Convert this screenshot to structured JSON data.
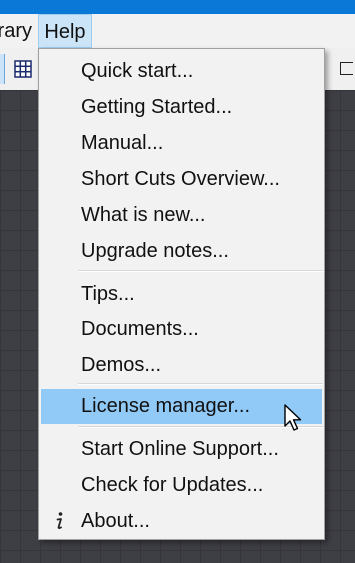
{
  "menubar": {
    "items": [
      {
        "label": "rary"
      },
      {
        "label": "Help"
      }
    ]
  },
  "help_menu": {
    "items": [
      {
        "label": "Quick start..."
      },
      {
        "label": "Getting Started..."
      },
      {
        "label": "Manual..."
      },
      {
        "label": "Short Cuts Overview..."
      },
      {
        "label": "What is new..."
      },
      {
        "label": "Upgrade notes..."
      },
      {
        "label": "Tips..."
      },
      {
        "label": "Documents..."
      },
      {
        "label": "Demos..."
      },
      {
        "label": "License manager...",
        "highlighted": true
      },
      {
        "label": "Start Online Support..."
      },
      {
        "label": "Check for Updates..."
      },
      {
        "label": "About...",
        "icon": "info-icon"
      }
    ]
  },
  "colors": {
    "titlebar": "#0a78d7",
    "menu_background": "#f2f2f2",
    "highlight": "#91c9f7",
    "canvas": "#3e3e45"
  }
}
